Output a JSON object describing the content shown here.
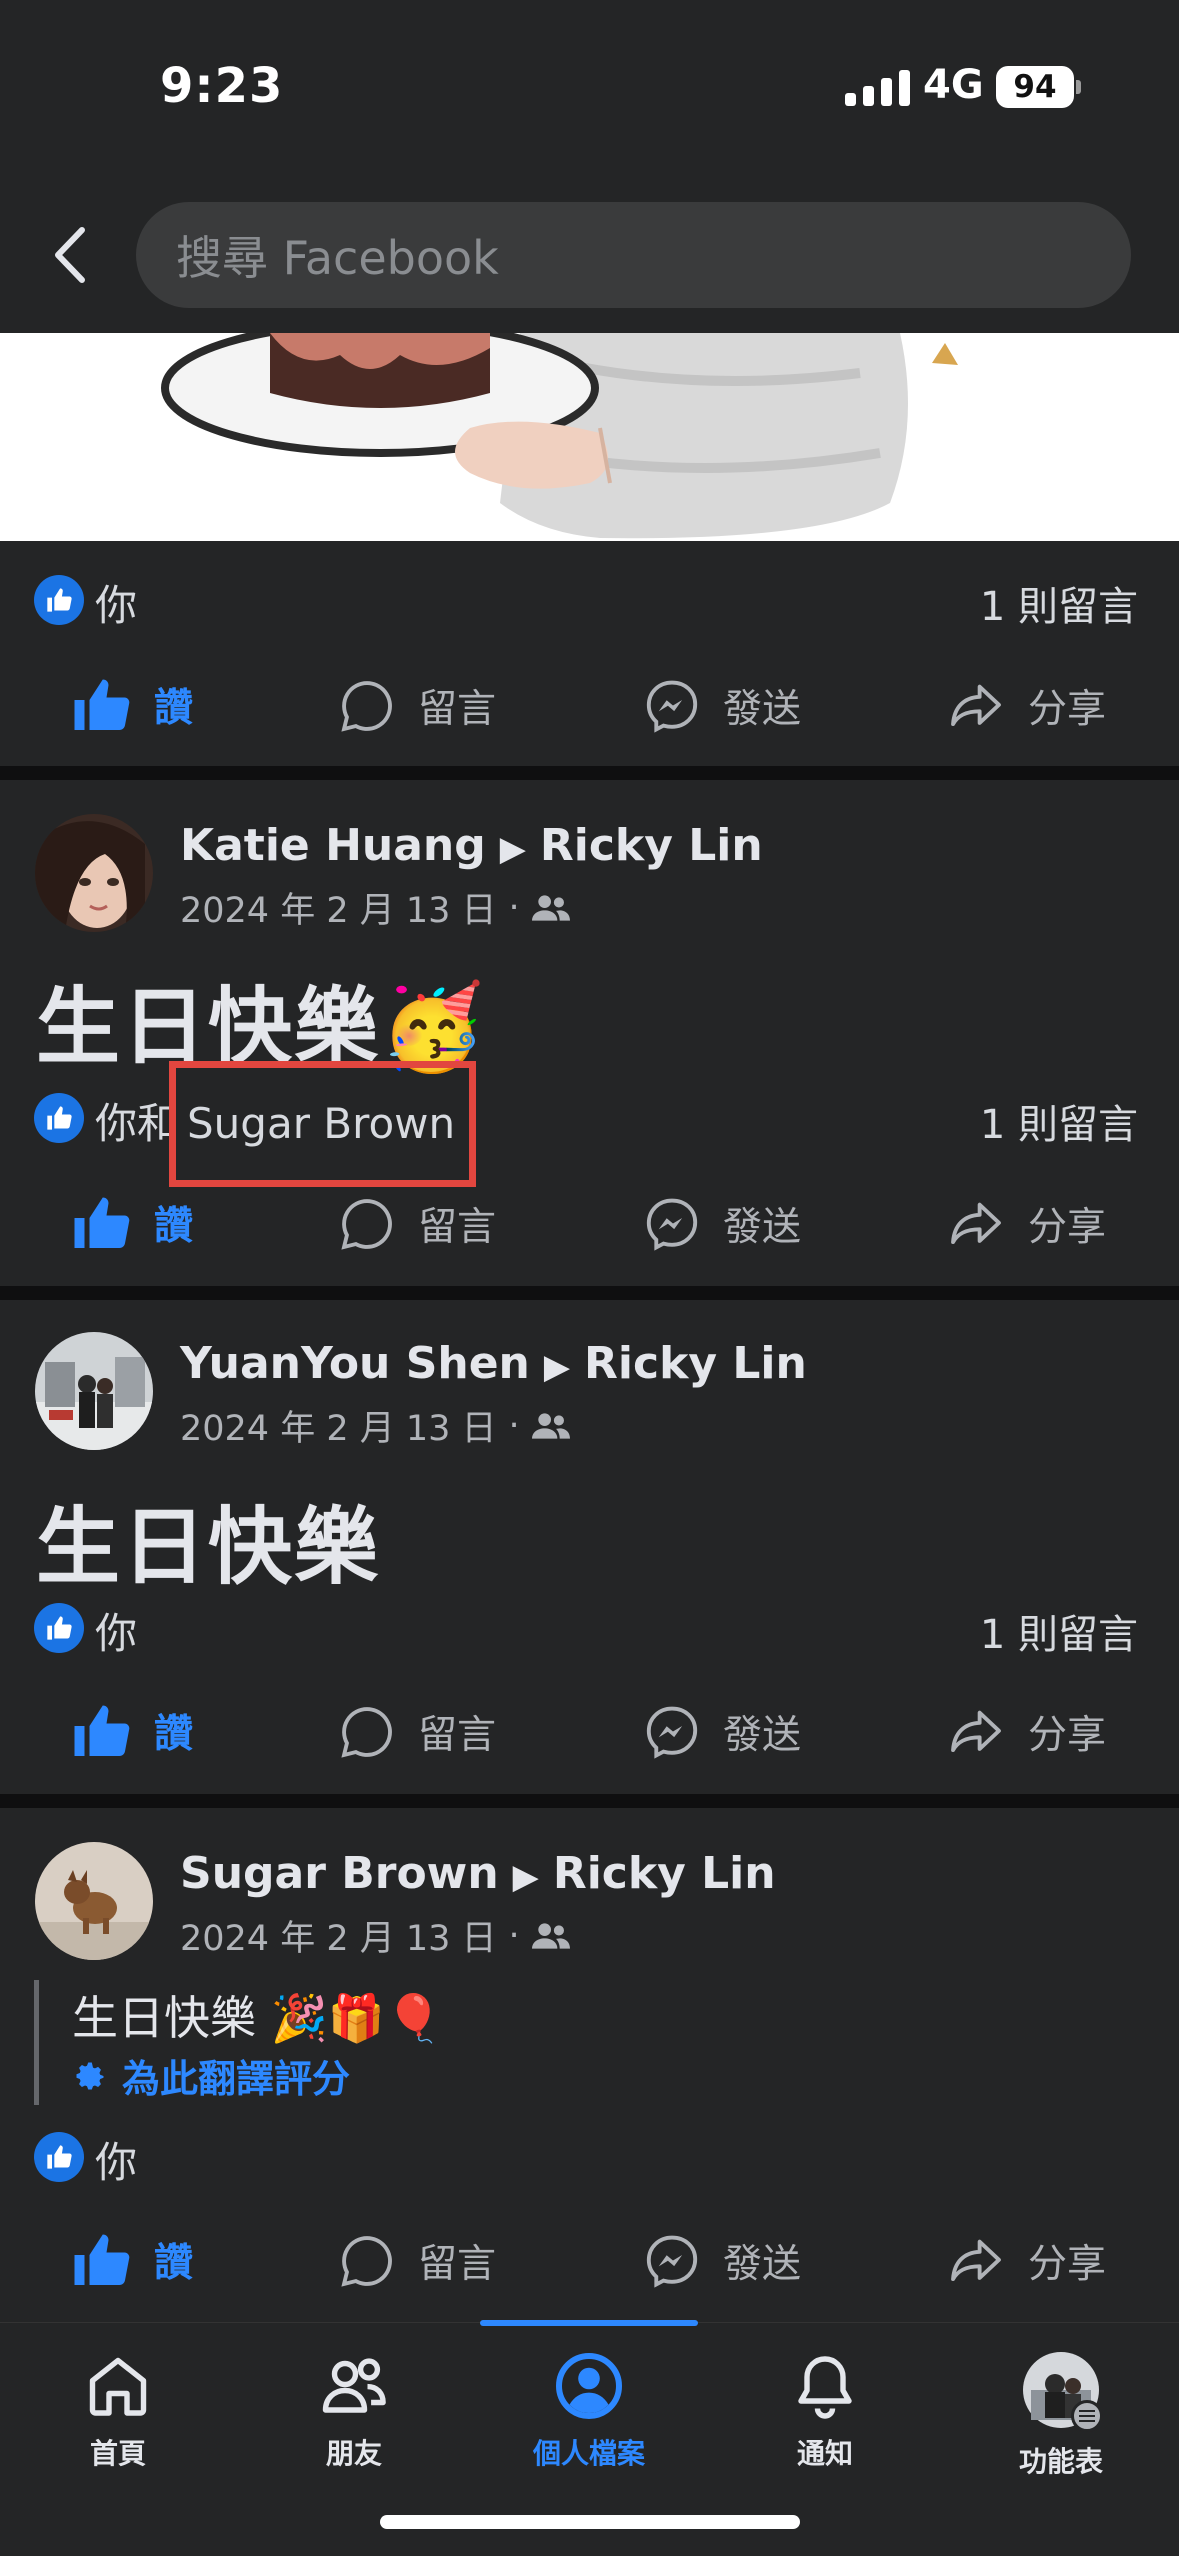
{
  "status_bar": {
    "time": "9:23",
    "network": "4G",
    "battery": "94"
  },
  "header": {
    "search_placeholder": "搜尋 Facebook"
  },
  "top_post": {
    "reactions": "你",
    "comment_count": "1 則留言"
  },
  "actions": {
    "like": "讚",
    "comment": "留言",
    "send": "發送",
    "share": "分享"
  },
  "posts": [
    {
      "author": "Katie Huang",
      "target": "Ricky Lin",
      "date": "2024 年 2 月 13 日",
      "text": "生日快樂🥳",
      "reactions_prefix": "你和",
      "reactions_name": "Sugar Brown",
      "comment_count": "1 則留言"
    },
    {
      "author": "YuanYou Shen",
      "target": "Ricky Lin",
      "date": "2024 年 2 月 13 日",
      "text": "生日快樂",
      "reactions": "你",
      "comment_count": "1 則留言"
    },
    {
      "author": "Sugar Brown",
      "target": "Ricky Lin",
      "date": "2024 年 2 月 13 日",
      "text": "生日快樂 🎉🎁🎈",
      "translate_link": "為此翻譯評分",
      "reactions": "你"
    }
  ],
  "tabs": [
    {
      "label": "首頁",
      "icon": "home-icon"
    },
    {
      "label": "朋友",
      "icon": "friends-icon"
    },
    {
      "label": "個人檔案",
      "icon": "profile-icon",
      "active": true
    },
    {
      "label": "通知",
      "icon": "bell-icon"
    },
    {
      "label": "功能表",
      "icon": "menu-avatar-icon"
    }
  ],
  "colors": {
    "accent": "#2d88ff",
    "highlight": "#e2463f",
    "background": "#242526"
  }
}
